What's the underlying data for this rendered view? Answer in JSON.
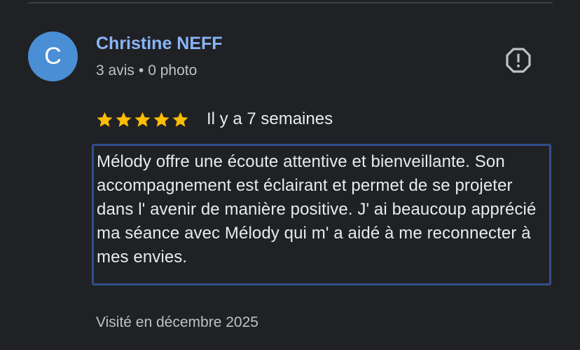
{
  "reviewer": {
    "initial": "C",
    "name": "Christine NEFF",
    "reviews_count": "3 avis",
    "separator": "•",
    "photos_count": "0 photo",
    "avatar_color": "#4a8fd6"
  },
  "review": {
    "rating": 5,
    "max_rating": 5,
    "star_color": "#fbbc04",
    "date": "Il y a 7 semaines",
    "text": "Mélody offre une écoute attentive et bienveillante. Son accompagnement est éclairant et permet de se projeter dans l' avenir de manière positive. J' ai beaucoup apprécié ma séance avec Mélody qui m' a aidé à me reconnecter à mes envies.",
    "visited": "Visité en décembre 2025"
  },
  "icons": {
    "report": "report-icon",
    "star": "star-icon"
  }
}
